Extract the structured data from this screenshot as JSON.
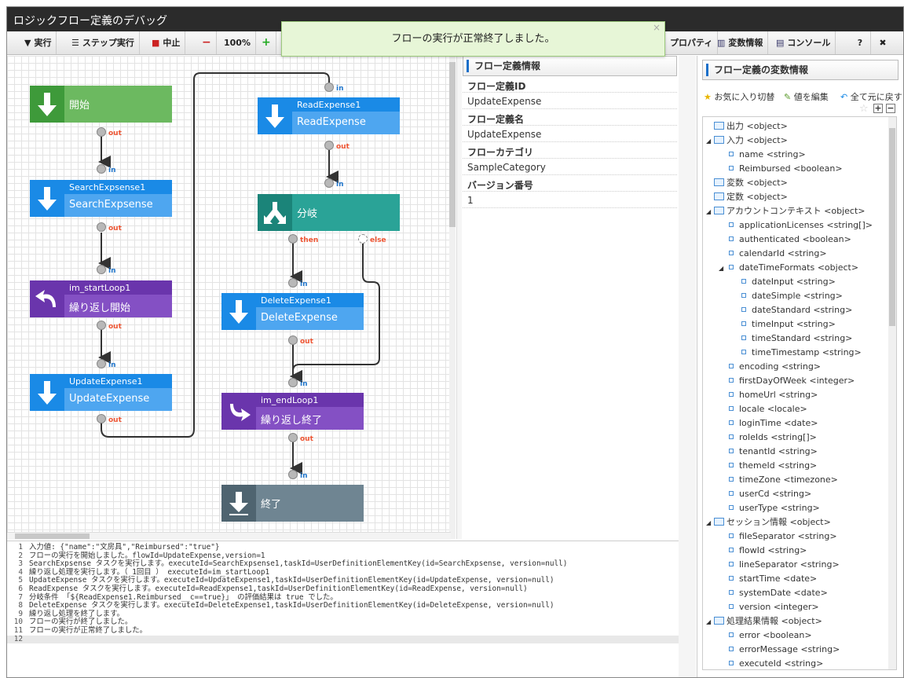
{
  "window": {
    "title": "ロジックフロー定義のデバッグ"
  },
  "toolbar": {
    "run": "実行",
    "step": "ステップ実行",
    "stop": "中止",
    "zoom": "100%",
    "properties": "プロパティ",
    "var_info": "変数情報",
    "console": "コンソール",
    "help": "?",
    "close_icon": "close-icon"
  },
  "toast": {
    "message": "フローの実行が正常終了しました。"
  },
  "flow": {
    "start": {
      "label": "開始"
    },
    "search": {
      "id": "SearchExpsense1",
      "name": "SearchExpsense"
    },
    "loop_start": {
      "id": "im_startLoop1",
      "name": "繰り返し開始"
    },
    "update": {
      "id": "UpdateExpense1",
      "name": "UpdateExpense"
    },
    "read": {
      "id": "ReadExpense1",
      "name": "ReadExpense"
    },
    "branch": {
      "label": "分岐",
      "then": "then",
      "else": "else"
    },
    "delete": {
      "id": "DeleteExpense1",
      "name": "DeleteExpense"
    },
    "loop_end": {
      "id": "im_endLoop1",
      "name": "繰り返し終了"
    },
    "end": {
      "label": "終了"
    },
    "in_label": "in",
    "out_label": "out"
  },
  "info": {
    "header": "フロー定義情報",
    "rows": [
      {
        "label": "フロー定義ID",
        "value": "UpdateExpense"
      },
      {
        "label": "フロー定義名",
        "value": "UpdateExpense"
      },
      {
        "label": "フローカテゴリ",
        "value": "SampleCategory"
      },
      {
        "label": "バージョン番号",
        "value": "1"
      }
    ]
  },
  "vars": {
    "header": "フロー定義の変数情報",
    "fav": "お気に入り切替",
    "edit": "値を編集",
    "reset": "全て元に戻す",
    "tree": [
      {
        "t": "出力 <object>",
        "lv": 0,
        "f": 1,
        "x": 0
      },
      {
        "t": "入力 <object>",
        "lv": 0,
        "f": 1,
        "x": 1
      },
      {
        "t": "name <string>",
        "lv": 1,
        "f": 0,
        "x": 0
      },
      {
        "t": "Reimbursed <boolean>",
        "lv": 1,
        "f": 0,
        "x": 0
      },
      {
        "t": "変数 <object>",
        "lv": 0,
        "f": 1,
        "x": 0
      },
      {
        "t": "定数 <object>",
        "lv": 0,
        "f": 1,
        "x": 0
      },
      {
        "t": "アカウントコンテキスト <object>",
        "lv": 0,
        "f": 1,
        "x": 1
      },
      {
        "t": "applicationLicenses <string[]>",
        "lv": 1,
        "f": 0,
        "x": 0
      },
      {
        "t": "authenticated <boolean>",
        "lv": 1,
        "f": 0,
        "x": 0
      },
      {
        "t": "calendarId <string>",
        "lv": 1,
        "f": 0,
        "x": 0
      },
      {
        "t": "dateTimeFormats <object>",
        "lv": 1,
        "f": 0,
        "x": 1
      },
      {
        "t": "dateInput <string>",
        "lv": 2,
        "f": 0,
        "x": 0
      },
      {
        "t": "dateSimple <string>",
        "lv": 2,
        "f": 0,
        "x": 0
      },
      {
        "t": "dateStandard <string>",
        "lv": 2,
        "f": 0,
        "x": 0
      },
      {
        "t": "timeInput <string>",
        "lv": 2,
        "f": 0,
        "x": 0
      },
      {
        "t": "timeStandard <string>",
        "lv": 2,
        "f": 0,
        "x": 0
      },
      {
        "t": "timeTimestamp <string>",
        "lv": 2,
        "f": 0,
        "x": 0
      },
      {
        "t": "encoding <string>",
        "lv": 1,
        "f": 0,
        "x": 0
      },
      {
        "t": "firstDayOfWeek <integer>",
        "lv": 1,
        "f": 0,
        "x": 0
      },
      {
        "t": "homeUrl <string>",
        "lv": 1,
        "f": 0,
        "x": 0
      },
      {
        "t": "locale <locale>",
        "lv": 1,
        "f": 0,
        "x": 0
      },
      {
        "t": "loginTime <date>",
        "lv": 1,
        "f": 0,
        "x": 0
      },
      {
        "t": "roleIds <string[]>",
        "lv": 1,
        "f": 0,
        "x": 0
      },
      {
        "t": "tenantId <string>",
        "lv": 1,
        "f": 0,
        "x": 0
      },
      {
        "t": "themeId <string>",
        "lv": 1,
        "f": 0,
        "x": 0
      },
      {
        "t": "timeZone <timezone>",
        "lv": 1,
        "f": 0,
        "x": 0
      },
      {
        "t": "userCd <string>",
        "lv": 1,
        "f": 0,
        "x": 0
      },
      {
        "t": "userType <string>",
        "lv": 1,
        "f": 0,
        "x": 0
      },
      {
        "t": "セッション情報 <object>",
        "lv": 0,
        "f": 1,
        "x": 1
      },
      {
        "t": "fileSeparator <string>",
        "lv": 1,
        "f": 0,
        "x": 0
      },
      {
        "t": "flowId <string>",
        "lv": 1,
        "f": 0,
        "x": 0
      },
      {
        "t": "lineSeparator <string>",
        "lv": 1,
        "f": 0,
        "x": 0
      },
      {
        "t": "startTime <date>",
        "lv": 1,
        "f": 0,
        "x": 0
      },
      {
        "t": "systemDate <date>",
        "lv": 1,
        "f": 0,
        "x": 0
      },
      {
        "t": "version <integer>",
        "lv": 1,
        "f": 0,
        "x": 0
      },
      {
        "t": "処理結果情報 <object>",
        "lv": 0,
        "f": 1,
        "x": 1
      },
      {
        "t": "error <boolean>",
        "lv": 1,
        "f": 0,
        "x": 0
      },
      {
        "t": "errorMessage <string>",
        "lv": 1,
        "f": 0,
        "x": 0
      },
      {
        "t": "executeId <string>",
        "lv": 1,
        "f": 0,
        "x": 0
      }
    ]
  },
  "console": {
    "lines": [
      "入力値: {\"name\":\"文房具\",\"Reimbursed\":\"true\"}",
      "フローの実行を開始しました。flowId=UpdateExpense,version=1",
      "SearchExpsense タスクを実行します。executeId=SearchExpsense1,taskId=UserDefinitionElementKey(id=SearchExpsense, version=null)",
      "繰り返し処理を実行します。（ 1回目 ） executeId=im_startLoop1",
      "UpdateExpense タスクを実行します。executeId=UpdateExpense1,taskId=UserDefinitionElementKey(id=UpdateExpense, version=null)",
      "ReadExpense タスクを実行します。executeId=ReadExpense1,taskId=UserDefinitionElementKey(id=ReadExpense, version=null)",
      "分岐条件 「${ReadExpense1.Reimbursed__c==true}」 の評価結果は true でした。",
      "DeleteExpense タスクを実行します。executeId=DeleteExpense1,taskId=UserDefinitionElementKey(id=DeleteExpense, version=null)",
      "繰り返し処理を終了します。",
      "フローの実行が終了しました。",
      "フローの実行が正常終了しました。",
      ""
    ]
  }
}
